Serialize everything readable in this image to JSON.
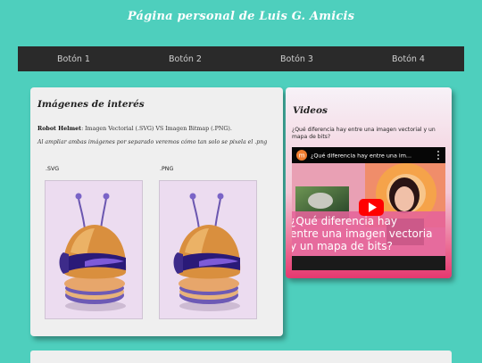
{
  "header": {
    "title": "Página personal de Luis G. Amicis"
  },
  "nav": {
    "buttons": [
      "Botón 1",
      "Botón 2",
      "Botón 3",
      "Botón 4"
    ]
  },
  "images_card": {
    "title": "Imágenes de interés",
    "desc_bold": "Robot Helmet",
    "desc_rest": ": Imagen Vectorial (.SVG) VS Imagen Bitmap (.PNG).",
    "note": "Al ampliar ambas imágenes por separado veremos cómo tan solo se pixela el .png",
    "label_svg": ".SVG",
    "label_png": ".PNG",
    "image_icon": "robot-helmet-icon"
  },
  "videos_card": {
    "title": "Videos",
    "question": "¿Qué diferencia hay entre una imagen vectorial y un mapa de bits?",
    "video": {
      "channel_initial": "m",
      "title": "¿Qué diferencia hay entre una im...",
      "thumbnail_caption": "¿Qué diferencia hay entre una imagen vectorial y un mapa de bits?",
      "play_icon": "play-icon",
      "menu_icon": "more-vert-icon"
    }
  },
  "colors": {
    "background": "#4ecfbd",
    "nav": "#2a2a2a",
    "card": "#efefef",
    "video_card_accent": "#e6386f"
  }
}
